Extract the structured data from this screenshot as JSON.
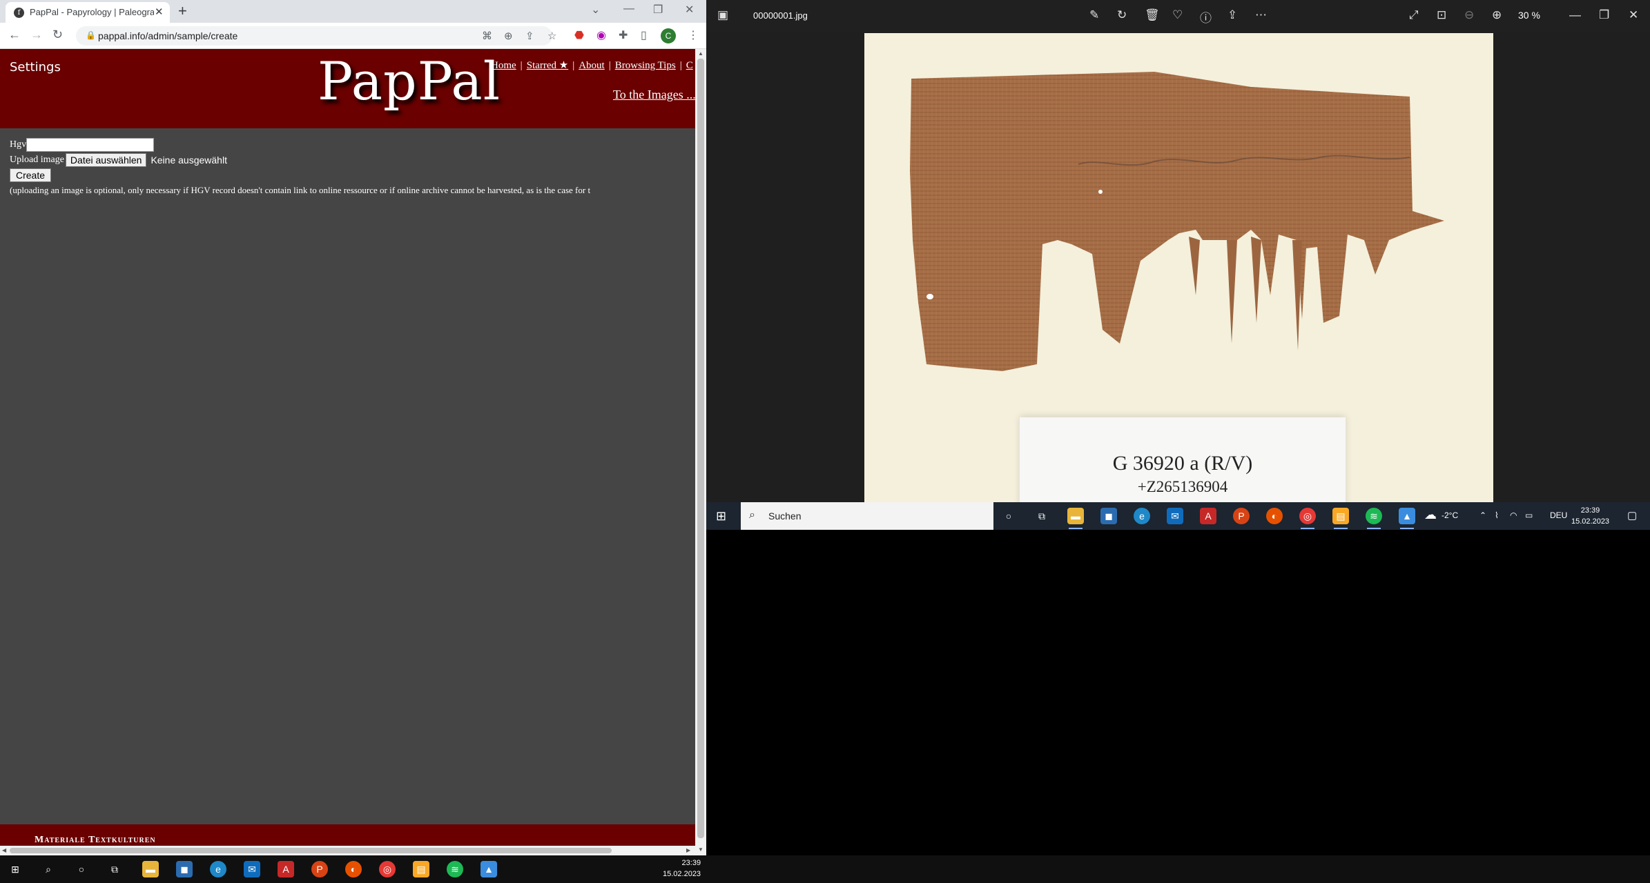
{
  "browser": {
    "tab": {
      "title": "PapPal - Papyrology | Paleography",
      "favicon": "f"
    },
    "address": {
      "url": "pappal.info/admin/sample/create"
    },
    "profile_initial": "C"
  },
  "site": {
    "settings_label": "Settings",
    "logo": "PapPal",
    "nav": [
      {
        "label": "Home"
      },
      {
        "label": "Starred ★"
      },
      {
        "label": "About"
      },
      {
        "label": "Browsing Tips"
      },
      {
        "label": "C"
      }
    ],
    "to_images": "To the Images ..."
  },
  "form": {
    "hgv_label": "Hgv",
    "hgv_value": "",
    "upload_label": "Upload image",
    "file_button": "Datei auswählen",
    "file_status": "Keine ausgewählt",
    "create_button": "Create",
    "note": "(uploading an image is optional, only necessary if HGV record doesn't contain link to online ressource or if online archive cannot be harvested, as is the case for t"
  },
  "footer": {
    "text": "Materiale Textkulturen"
  },
  "viewer": {
    "file_name": "00000001.jpg",
    "zoom": "30 %",
    "label_line1": "G 36920 a (R/V)",
    "label_line2": "+Z265136904"
  },
  "taskbar_viewer": {
    "search_placeholder": "Suchen",
    "temperature": "-2°C",
    "language": "DEU",
    "time": "23:39",
    "date": "15.02.2023"
  },
  "taskbar_main": {
    "time": "23:39",
    "date": "15.02.2023"
  }
}
